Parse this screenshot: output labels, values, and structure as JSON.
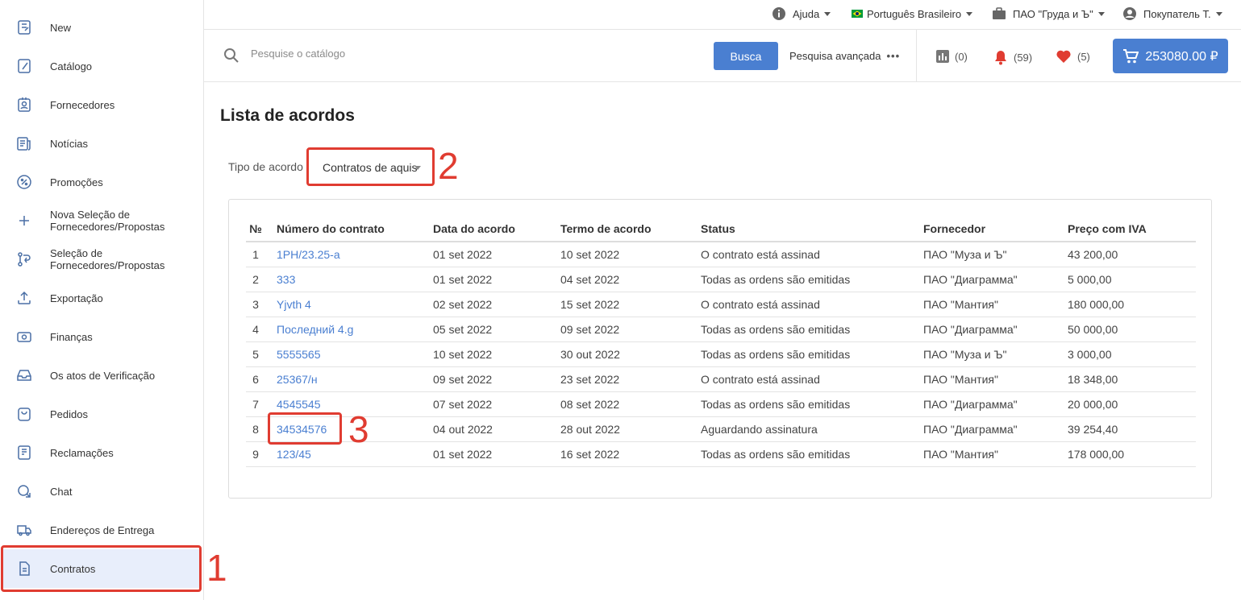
{
  "sidebar": {
    "items": [
      {
        "label": "New",
        "icon": "book-icon"
      },
      {
        "label": "Catálogo",
        "icon": "catalog-icon"
      },
      {
        "label": "Fornecedores",
        "icon": "supplier-icon"
      },
      {
        "label": "Notícias",
        "icon": "news-icon"
      },
      {
        "label": "Promoções",
        "icon": "percent-icon"
      },
      {
        "label": "Nova Seleção de Fornecedores/Propostas",
        "icon": "plus-icon"
      },
      {
        "label": "Seleção de Fornecedores/Propostas",
        "icon": "swap-icon"
      },
      {
        "label": "Exportação",
        "icon": "upload-icon"
      },
      {
        "label": "Finanças",
        "icon": "money-icon"
      },
      {
        "label": "Os atos de Verificação",
        "icon": "inbox-icon"
      },
      {
        "label": "Pedidos",
        "icon": "bag-icon"
      },
      {
        "label": "Reclamações",
        "icon": "complaint-icon"
      },
      {
        "label": "Chat",
        "icon": "chat-icon"
      },
      {
        "label": "Endereços de Entrega",
        "icon": "truck-icon"
      },
      {
        "label": "Contratos",
        "icon": "document-icon"
      }
    ]
  },
  "topbar": {
    "help": "Ajuda",
    "language": "Português Brasileiro",
    "company": "ПАО \"Груда и Ъ\"",
    "user": "Покупатель Т."
  },
  "search": {
    "placeholder": "Pesquise o catálogo",
    "button": "Busca",
    "advanced": "Pesquisa avançada",
    "compare_count": "(0)",
    "notifications_count": "(59)",
    "favorites_count": "(5)",
    "cart_total": "253080.00 ₽"
  },
  "page": {
    "title": "Lista de acordos",
    "filter_label": "Tipo de acordo",
    "filter_value": "Contratos de aquis"
  },
  "table": {
    "headers": [
      "№",
      "Número do contrato",
      "Data do acordo",
      "Termo de acordo",
      "Status",
      "Fornecedor",
      "Preço com IVA"
    ],
    "rows": [
      [
        "1",
        "1PH/23.25-a",
        "01 set 2022",
        "10 set 2022",
        "O contrato está assinad",
        "ПАО \"Муза и Ъ\"",
        "43 200,00"
      ],
      [
        "2",
        "333",
        "01 set 2022",
        "04 set 2022",
        "Todas as ordens são emitidas",
        "ПАО \"Диаграмма\"",
        "5 000,00"
      ],
      [
        "3",
        "Yjvth 4",
        "02 set 2022",
        "15 set 2022",
        "O contrato está assinad",
        "ПАО \"Мантия\"",
        "180 000,00"
      ],
      [
        "4",
        "Последний 4.g",
        "05 set 2022",
        "09 set 2022",
        "Todas as ordens são emitidas",
        "ПАО \"Диаграмма\"",
        "50 000,00"
      ],
      [
        "5",
        "5555565",
        "10 set 2022",
        "30 out 2022",
        "Todas as ordens são emitidas",
        "ПАО \"Муза и Ъ\"",
        "3 000,00"
      ],
      [
        "6",
        "25367/н",
        "09 set 2022",
        "23 set 2022",
        "O contrato está assinad",
        "ПАО \"Мантия\"",
        "18 348,00"
      ],
      [
        "7",
        "4545545",
        "07 set 2022",
        "08 set 2022",
        "Todas as ordens são emitidas",
        "ПАО \"Диаграмма\"",
        "20 000,00"
      ],
      [
        "8",
        "34534576",
        "04 out 2022",
        "28 out 2022",
        "Aguardando assinatura",
        "ПАО \"Диаграмма\"",
        "39 254,40"
      ],
      [
        "9",
        "123/45",
        "01 set 2022",
        "16 set 2022",
        "Todas as ordens são emitidas",
        "ПАО \"Мантия\"",
        "178 000,00"
      ]
    ]
  },
  "annotations": [
    "1",
    "2",
    "3"
  ],
  "colors": {
    "accent": "#4a7fd1",
    "highlight": "#e03c31",
    "active_bg": "#e8eefb"
  }
}
